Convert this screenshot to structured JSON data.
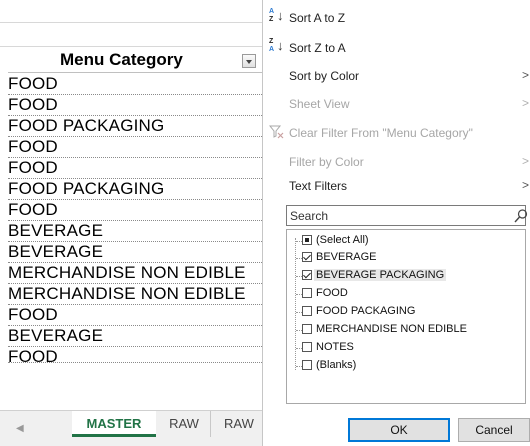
{
  "sheet": {
    "header": "Menu Category",
    "rows": [
      "FOOD",
      "FOOD",
      "FOOD PACKAGING",
      "FOOD",
      "FOOD",
      "FOOD PACKAGING",
      "FOOD",
      "BEVERAGE",
      "BEVERAGE",
      "MERCHANDISE NON EDIBLE",
      "MERCHANDISE NON EDIBLE",
      "FOOD",
      "BEVERAGE",
      "FOOD"
    ],
    "tabs": [
      "MASTER",
      "RAW",
      "RAW"
    ]
  },
  "menu": {
    "sort_az": "Sort A to Z",
    "sort_za": "Sort Z to A",
    "sort_by_color": "Sort by Color",
    "sheet_view": "Sheet View",
    "clear_filter": "Clear Filter From \"Menu Category\"",
    "filter_by_color": "Filter by Color",
    "text_filters": "Text Filters",
    "arrow": ">"
  },
  "search": {
    "placeholder": "Search"
  },
  "filter_list": [
    {
      "label": "(Select All)",
      "state": "partial"
    },
    {
      "label": "BEVERAGE",
      "state": "checked"
    },
    {
      "label": "BEVERAGE PACKAGING",
      "state": "checked"
    },
    {
      "label": "FOOD",
      "state": "unchecked"
    },
    {
      "label": "FOOD PACKAGING",
      "state": "unchecked"
    },
    {
      "label": "MERCHANDISE NON EDIBLE",
      "state": "unchecked"
    },
    {
      "label": "NOTES",
      "state": "unchecked"
    },
    {
      "label": "(Blanks)",
      "state": "unchecked"
    }
  ],
  "buttons": {
    "ok": "OK",
    "cancel": "Cancel"
  },
  "colors": {
    "excel_green": "#217346",
    "focus_blue": "#0078d7"
  }
}
